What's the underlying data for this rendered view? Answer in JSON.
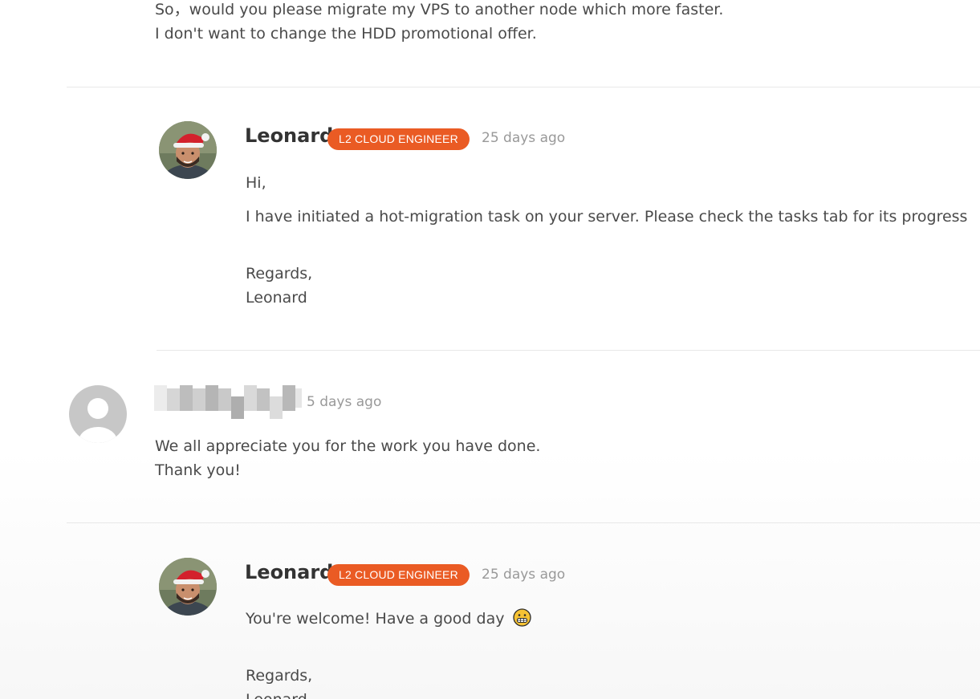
{
  "thread": {
    "top_message": {
      "lines": [
        "So，would you please migrate my VPS to another node which more faster.",
        "I don't want to change the HDD promotional offer."
      ]
    },
    "reply1": {
      "author": "Leonard",
      "badge": "L2 CLOUD ENGINEER",
      "time": "25 days ago",
      "greeting": "Hi,",
      "body": "I have initiated a hot-migration task on your server. Please check the tasks tab for its progress",
      "regards": "Regards,",
      "signature": "Leonard"
    },
    "customer": {
      "time": "5 days ago",
      "lines": [
        "We all appreciate you for the work you have done.",
        "Thank you!"
      ]
    },
    "reply2": {
      "author": "Leonard",
      "badge": "L2 CLOUD ENGINEER",
      "time": "25 days ago",
      "body": "You're welcome! Have a good day",
      "emoji": "😁",
      "regards": "Regards,",
      "signature": "Leonard"
    }
  },
  "colors": {
    "badge": "#ea5b24",
    "text": "#4a4a4a",
    "muted": "#999999",
    "divider": "#e8e8e8"
  },
  "icons": {
    "staff_avatar": "staff-avatar",
    "default_avatar": "default-user-avatar"
  }
}
